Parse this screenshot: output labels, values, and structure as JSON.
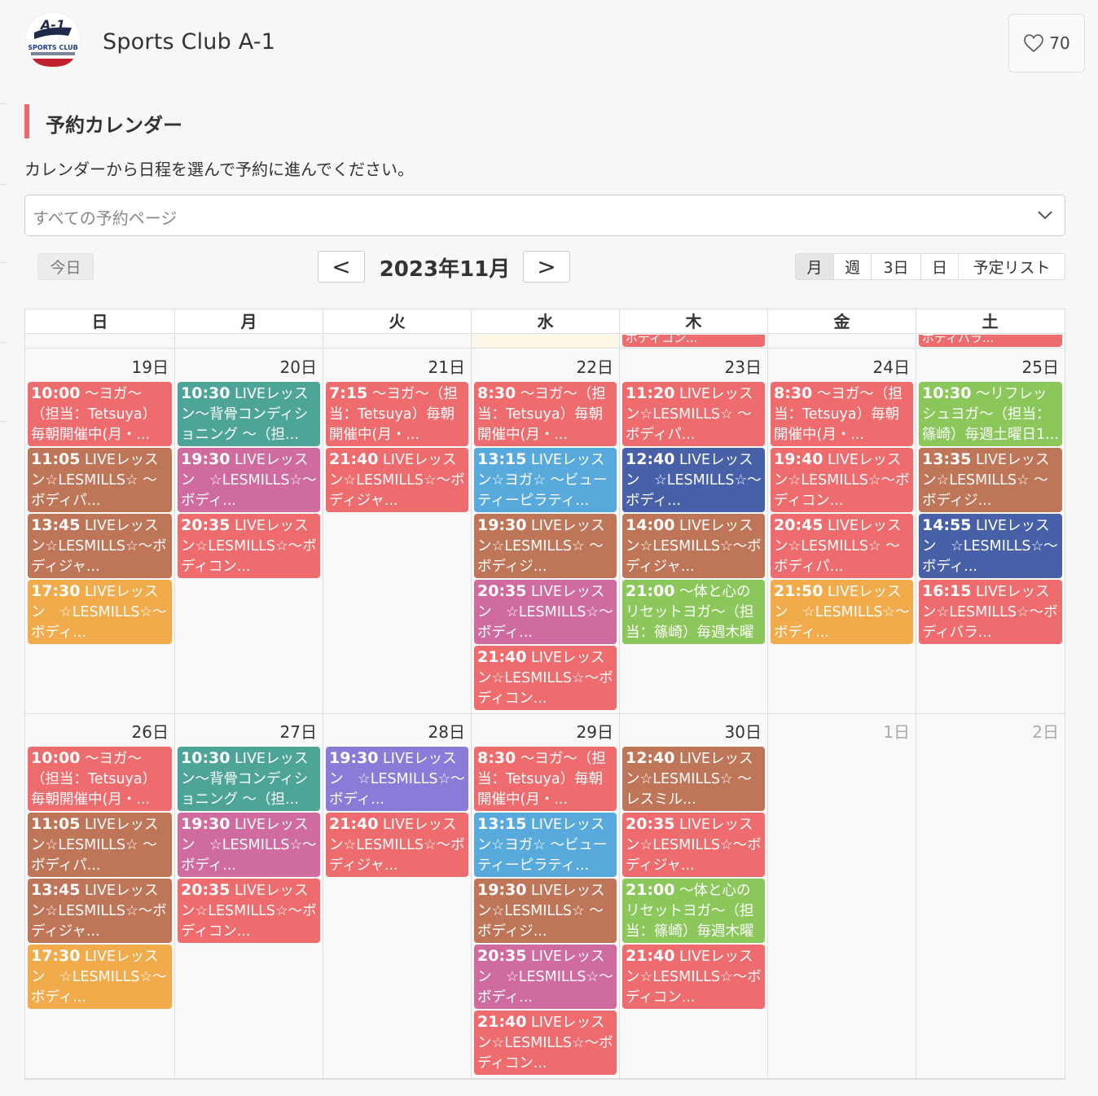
{
  "header": {
    "title": "Sports Club A-1",
    "logo_text": "A-1",
    "logo_sub": "SPORTS CLUB",
    "like_count": "70"
  },
  "section": {
    "title": "予約カレンダー",
    "intro": "カレンダーから日程を選んで予約に進んでください。"
  },
  "page_select": {
    "value": "すべての予約ページ"
  },
  "toolbar": {
    "today": "今日",
    "prev": "<",
    "next": ">",
    "month": "2023年11月",
    "views": [
      "月",
      "週",
      "3日",
      "日",
      "予定リスト"
    ],
    "active_view": "月"
  },
  "colors": {
    "red": "#ee6b6e",
    "brown": "#bf7658",
    "teal": "#4ca596",
    "pink": "#d06ba0",
    "orange": "#f2ab4b",
    "blue": "#58a9dc",
    "navy": "#4860a8",
    "green": "#8bc75a",
    "purple": "#8c7ad8",
    "accent": "#e8696d"
  },
  "calendar": {
    "weekdays": [
      "日",
      "月",
      "火",
      "水",
      "木",
      "金",
      "土"
    ],
    "prev_week_stub": [
      {
        "col": 4,
        "text": "ボディコン...",
        "color": "red"
      },
      {
        "col": 6,
        "text": "ボディバラ...",
        "color": "red"
      }
    ],
    "weeks": [
      {
        "days": [
          {
            "label": "19日",
            "events": [
              {
                "time": "10:00",
                "text": " ～ヨガ～（担当：Tetsuya）毎朝開催中(月・...",
                "color": "red"
              },
              {
                "time": "11:05",
                "text": " LIVEレッスン☆LESMILLS☆ ～ボディパ...",
                "color": "brown"
              },
              {
                "time": "13:45",
                "text": " LIVEレッスン☆LESMILLS☆～ボディジャ...",
                "color": "brown"
              },
              {
                "time": "17:30",
                "text": " LIVEレッスン　☆LESMILLS☆～ボディ...",
                "color": "orange"
              }
            ]
          },
          {
            "label": "20日",
            "events": [
              {
                "time": "10:30",
                "text": " LIVEレッスン～背骨コンディショニング ～（担...",
                "color": "teal"
              },
              {
                "time": "19:30",
                "text": " LIVEレッスン　☆LESMILLS☆～ボディ...",
                "color": "pink"
              },
              {
                "time": "20:35",
                "text": " LIVEレッスン☆LESMILLS☆～ボディコン...",
                "color": "red"
              }
            ]
          },
          {
            "label": "21日",
            "events": [
              {
                "time": "7:15",
                "text": " ～ヨガ～（担当：Tetsuya）毎朝開催中(月・...",
                "color": "red"
              },
              {
                "time": "21:40",
                "text": " LIVEレッスン☆LESMILLS☆～ボディジャ...",
                "color": "red"
              }
            ]
          },
          {
            "label": "22日",
            "events": [
              {
                "time": "8:30",
                "text": " ～ヨガ～（担当：Tetsuya）毎朝開催中(月・...",
                "color": "red"
              },
              {
                "time": "13:15",
                "text": " LIVEレッスン☆ヨガ☆ ～ビューティーピラティ...",
                "color": "blue"
              },
              {
                "time": "19:30",
                "text": " LIVEレッスン☆LESMILLS☆ ～ボディジ...",
                "color": "brown"
              },
              {
                "time": "20:35",
                "text": " LIVEレッスン　☆LESMILLS☆～ボディ...",
                "color": "pink"
              },
              {
                "time": "21:40",
                "text": " LIVEレッスン☆LESMILLS☆～ボディコン...",
                "color": "red"
              }
            ]
          },
          {
            "label": "23日",
            "events": [
              {
                "time": "11:20",
                "text": " LIVEレッスン☆LESMILLS☆ ～ボディパ...",
                "color": "red"
              },
              {
                "time": "12:40",
                "text": " LIVEレッスン　☆LESMILLS☆～ボディ...",
                "color": "navy"
              },
              {
                "time": "14:00",
                "text": " LIVEレッスン☆LESMILLS☆～ボディジャ...",
                "color": "brown"
              },
              {
                "time": "21:00",
                "text": " ～体と心のリセットヨガ～（担当：篠崎）毎週木曜日...",
                "color": "green"
              }
            ]
          },
          {
            "label": "24日",
            "events": [
              {
                "time": "8:30",
                "text": " ～ヨガ～（担当：Tetsuya）毎朝開催中(月・...",
                "color": "red"
              },
              {
                "time": "19:40",
                "text": " LIVEレッスン☆LESMILLS☆～ボディコン...",
                "color": "red"
              },
              {
                "time": "20:45",
                "text": " LIVEレッスン☆LESMILLS☆ ～ボディパ...",
                "color": "red"
              },
              {
                "time": "21:50",
                "text": " LIVEレッスン　☆LESMILLS☆～ボディ...",
                "color": "orange"
              }
            ]
          },
          {
            "label": "25日",
            "events": [
              {
                "time": "10:30",
                "text": " ～リフレッシュヨガ～（担当：篠崎）毎週土曜日1...",
                "color": "green"
              },
              {
                "time": "13:35",
                "text": " LIVEレッスン☆LESMILLS☆ ～ボディジ...",
                "color": "brown"
              },
              {
                "time": "14:55",
                "text": " LIVEレッスン　☆LESMILLS☆～ボディ...",
                "color": "navy"
              },
              {
                "time": "16:15",
                "text": " LIVEレッスン☆LESMILLS☆～ボディバラ...",
                "color": "red"
              }
            ]
          }
        ]
      },
      {
        "days": [
          {
            "label": "26日",
            "events": [
              {
                "time": "10:00",
                "text": " ～ヨガ～（担当：Tetsuya）毎朝開催中(月・...",
                "color": "red"
              },
              {
                "time": "11:05",
                "text": " LIVEレッスン☆LESMILLS☆ ～ボディパ...",
                "color": "brown"
              },
              {
                "time": "13:45",
                "text": " LIVEレッスン☆LESMILLS☆～ボディジャ...",
                "color": "brown"
              },
              {
                "time": "17:30",
                "text": " LIVEレッスン　☆LESMILLS☆～ボディ...",
                "color": "orange"
              }
            ]
          },
          {
            "label": "27日",
            "events": [
              {
                "time": "10:30",
                "text": " LIVEレッスン～背骨コンディショニング ～（担...",
                "color": "teal"
              },
              {
                "time": "19:30",
                "text": " LIVEレッスン　☆LESMILLS☆～ボディ...",
                "color": "pink"
              },
              {
                "time": "20:35",
                "text": " LIVEレッスン☆LESMILLS☆～ボディコン...",
                "color": "red"
              }
            ]
          },
          {
            "label": "28日",
            "events": [
              {
                "time": "19:30",
                "text": " LIVEレッスン　☆LESMILLS☆～ボディ...",
                "color": "purple"
              },
              {
                "time": "21:40",
                "text": " LIVEレッスン☆LESMILLS☆～ボディジャ...",
                "color": "red"
              }
            ]
          },
          {
            "label": "29日",
            "events": [
              {
                "time": "8:30",
                "text": " ～ヨガ～（担当：Tetsuya）毎朝開催中(月・...",
                "color": "red"
              },
              {
                "time": "13:15",
                "text": " LIVEレッスン☆ヨガ☆ ～ビューティーピラティ...",
                "color": "blue"
              },
              {
                "time": "19:30",
                "text": " LIVEレッスン☆LESMILLS☆ ～ボディジ...",
                "color": "brown"
              },
              {
                "time": "20:35",
                "text": " LIVEレッスン　☆LESMILLS☆～ボディ...",
                "color": "pink"
              },
              {
                "time": "21:40",
                "text": " LIVEレッスン☆LESMILLS☆～ボディコン...",
                "color": "red"
              }
            ]
          },
          {
            "label": "30日",
            "events": [
              {
                "time": "12:40",
                "text": " LIVEレッスン☆LESMILLS☆ ～レスミル...",
                "color": "brown"
              },
              {
                "time": "20:35",
                "text": " LIVEレッスン☆LESMILLS☆～ボディジャ...",
                "color": "red"
              },
              {
                "time": "21:00",
                "text": " ～体と心のリセットヨガ～（担当：篠崎）毎週木曜日...",
                "color": "green"
              },
              {
                "time": "21:40",
                "text": " LIVEレッスン☆LESMILLS☆～ボディコン...",
                "color": "red"
              }
            ]
          },
          {
            "label": "1日",
            "dim": true,
            "events": []
          },
          {
            "label": "2日",
            "dim": true,
            "events": []
          }
        ]
      }
    ]
  }
}
